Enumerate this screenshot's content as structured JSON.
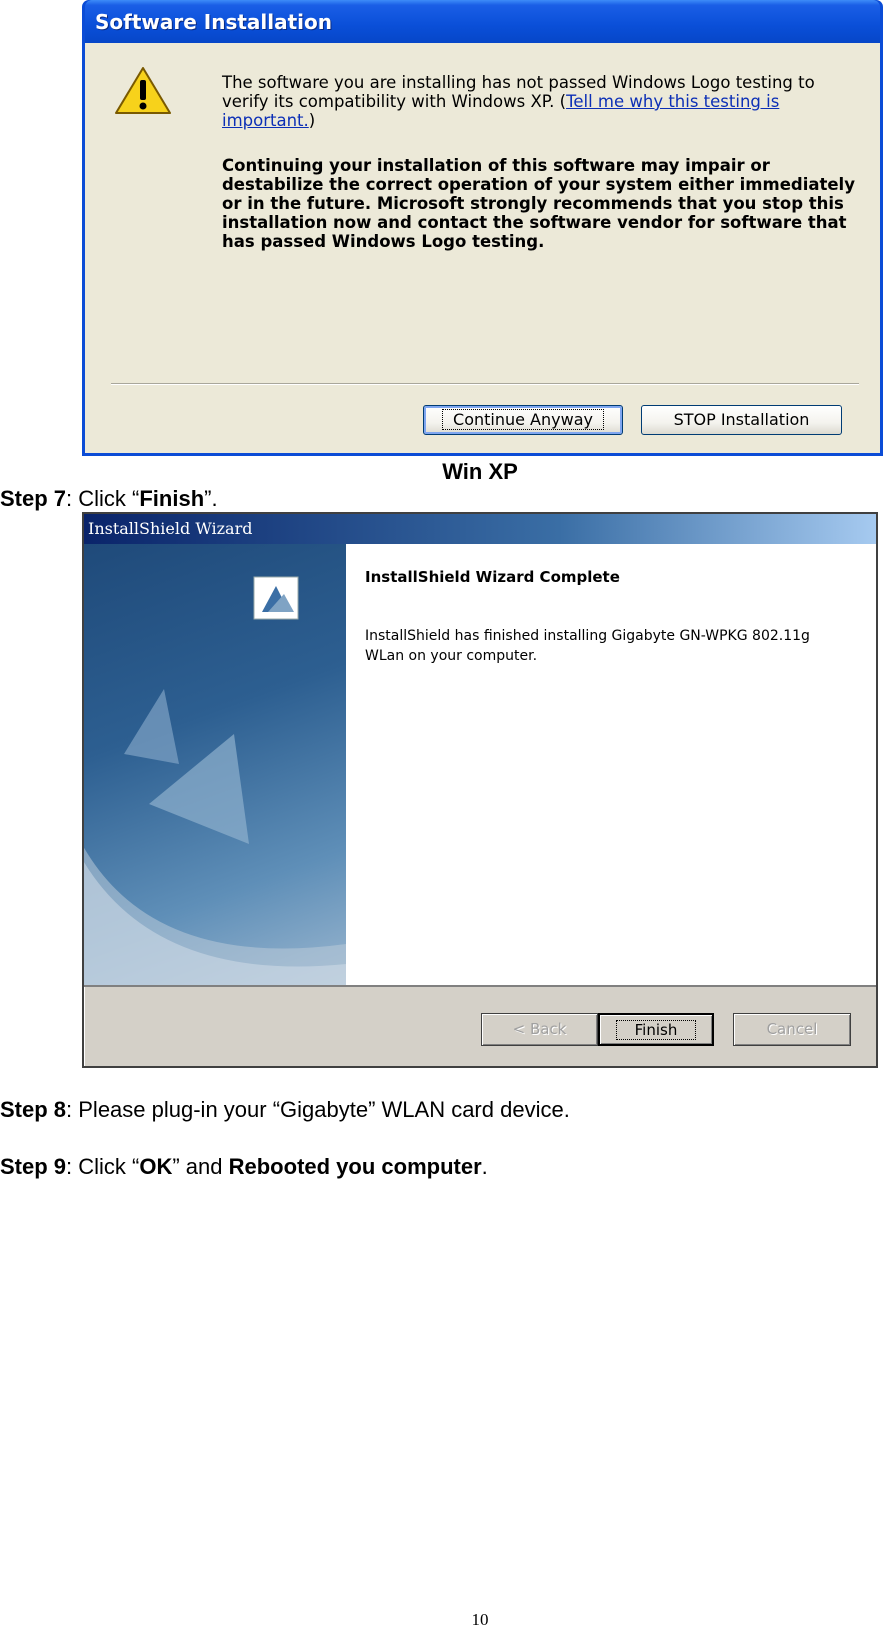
{
  "xp_dialog": {
    "title": "Software Installation",
    "icon": "warning-icon",
    "message1_pre": "The software you are installing has not passed Windows Logo testing to verify its compatibility with Windows XP. (",
    "message1_link": "Tell me why this testing is important.",
    "message1_post": ")",
    "message2": "Continuing your installation of this software may impair or destabilize the correct operation of your system either immediately or in the future. Microsoft strongly recommends that you stop this installation now and contact the software vendor for software that has passed Windows Logo testing.",
    "buttons": {
      "continue": "Continue Anyway",
      "stop": "STOP Installation"
    }
  },
  "caption": "Win XP",
  "step7": {
    "label": "Step 7",
    "pre": ": Click “",
    "bold": "Finish",
    "post": "”."
  },
  "installshield": {
    "title": "InstallShield Wizard",
    "heading": "InstallShield Wizard Complete",
    "text": "InstallShield has finished installing Gigabyte GN-WPKG 802.11g WLan on your computer.",
    "buttons": {
      "back": "< Back",
      "finish": "Finish",
      "cancel": "Cancel"
    }
  },
  "step8": {
    "label": "Step 8",
    "text": ": Please plug-in your “Gigabyte” WLAN card device."
  },
  "step9": {
    "label": "Step 9",
    "pre": ": Click “",
    "bold1": "OK",
    "mid": "” and ",
    "bold2": "Rebooted you computer",
    "post": "."
  },
  "page_number": "10",
  "colors": {
    "xp_title": "#0a4fd8",
    "xp_body": "#ece9d8",
    "is_title": "#0a246a",
    "link": "#0c2fb6"
  }
}
